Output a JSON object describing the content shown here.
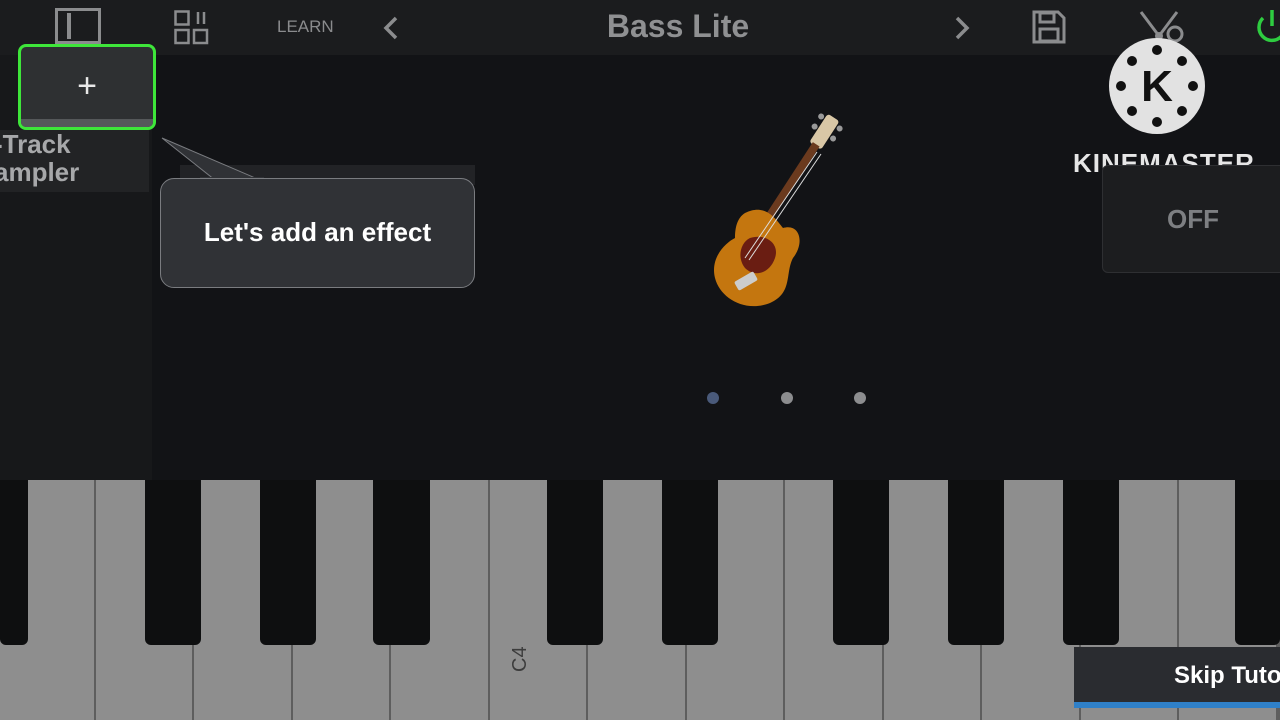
{
  "toolbar": {
    "learn_label": "LEARN",
    "instrument_title": "Bass Lite",
    "prev_icon": "chevron-left-icon",
    "next_icon": "chevron-right-icon",
    "save_icon": "save-icon",
    "routing_icon": "routing-icon",
    "power_icon": "power-icon",
    "panel_icon": "panel-toggle-icon",
    "grid_icon": "layout-grid-icon"
  },
  "left_panel": {
    "add_label": "+",
    "track_label_line1": "-Track",
    "track_label_line2": "ampler"
  },
  "tooltip": {
    "text": "Let's add an effect"
  },
  "effect": {
    "off_label": "OFF"
  },
  "watermark": {
    "text": "KINEMASTER",
    "logo_letter": "K"
  },
  "pager": {
    "pages": 3,
    "active": 1
  },
  "keyboard": {
    "c4_label": "C4"
  },
  "tutorial": {
    "skip_label": "Skip Tuto"
  },
  "colors": {
    "highlight": "#3ee63a",
    "power": "#2ecc40",
    "active_dot": "#4a5a7a",
    "progress": "#2f80c8"
  }
}
